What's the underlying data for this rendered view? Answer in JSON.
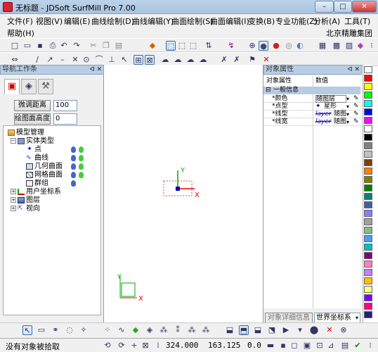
{
  "window": {
    "title": "无标题 - JDSoft SurfMill Pro 7.00"
  },
  "menu": {
    "row1": [
      "文件(F)",
      "视图(V)",
      "编辑(E)",
      "曲线绘制(D)",
      "曲线编辑(Y)",
      "曲面绘制(S)",
      "曲面编辑(I)",
      "变换(B)",
      "专业功能(Z)",
      "分析(A)",
      "工具(T)"
    ],
    "row2": [
      "帮助(H)"
    ],
    "company": "北京精雕集团"
  },
  "toolbar1_icons": [
    "new-icon",
    "open-icon",
    "save-icon",
    "print-icon",
    "undo-icon",
    "redo-icon",
    "cut-icon",
    "copy-icon",
    "paste-icon",
    "box-icon",
    "view-iso-icon",
    "view-front-icon",
    "view-top-icon",
    "view-right-icon",
    "shade-icon",
    "sphere-wire-icon",
    "sphere-shade-icon",
    "sphere-red-icon",
    "sphere-gray-icon",
    "grid-icon",
    "layers-icon",
    "more-icon"
  ],
  "toolbar2_icons": [
    "snap-icon",
    "line-icon",
    "endpoint-icon",
    "midpoint-icon",
    "cross-icon",
    "center-icon",
    "tangent-icon",
    "perp-icon",
    "point-icon",
    "box-snap-icon",
    "curve-icon",
    "surface-icon",
    "solid-icon",
    "trim-icon",
    "extend-icon",
    "measure-icon",
    "close-x-icon"
  ],
  "navigator": {
    "title": "导航工作条",
    "btn_fine": "微调距离",
    "fine_value": "100",
    "btn_height": "绘图面高度",
    "height_value": "0",
    "tree": {
      "root": "模型管理",
      "solid_type": "实体类型",
      "point": "点",
      "curve": "曲线",
      "geo_surface": "几何曲面",
      "mesh_surface": "网格曲面",
      "group": "群组",
      "ucs": "用户坐标系",
      "layer": "图层",
      "view": "视向"
    }
  },
  "viewport": {
    "axis_y": "Y",
    "axis_x": "X"
  },
  "properties": {
    "title": "对象属性",
    "col_name": "对象属性",
    "col_value": "数值",
    "section": "一般信息",
    "rows": [
      {
        "name": "*颜色",
        "value": "随图层"
      },
      {
        "name": "*点型",
        "value": "星形"
      },
      {
        "name": "*线型",
        "value": "随图"
      },
      {
        "name": "*线宽",
        "value": "随图"
      }
    ],
    "layer_tag": "layer",
    "details_btn": "对象详细信息",
    "coord_select": "世界坐标系"
  },
  "palette": [
    "#ffffff",
    "#ff0000",
    "#ffff00",
    "#00ff00",
    "#00ffff",
    "#0000ff",
    "#ff00ff",
    "#ffffff",
    "#000000",
    "#808080",
    "#c0c0c0",
    "#804000",
    "#ff8000",
    "#808000",
    "#008000",
    "#008080",
    "#000080",
    "#800080",
    "#ff8080",
    "#80ff80",
    "#8080ff",
    "#ffff80",
    "#80ffff",
    "#ff80ff",
    "#400000",
    "#404000",
    "#004000",
    "#004040",
    "#000040",
    "#400040",
    "#ff4000",
    "#40ff00",
    "#0040ff",
    "#ff0040",
    "#00ff40",
    "#4000ff",
    "#ff8040",
    "#ffc000",
    "#c0ff00"
  ],
  "status": {
    "message": "没有对象被拾取",
    "x": "324.000",
    "y": "163.125",
    "z": "0.0"
  }
}
